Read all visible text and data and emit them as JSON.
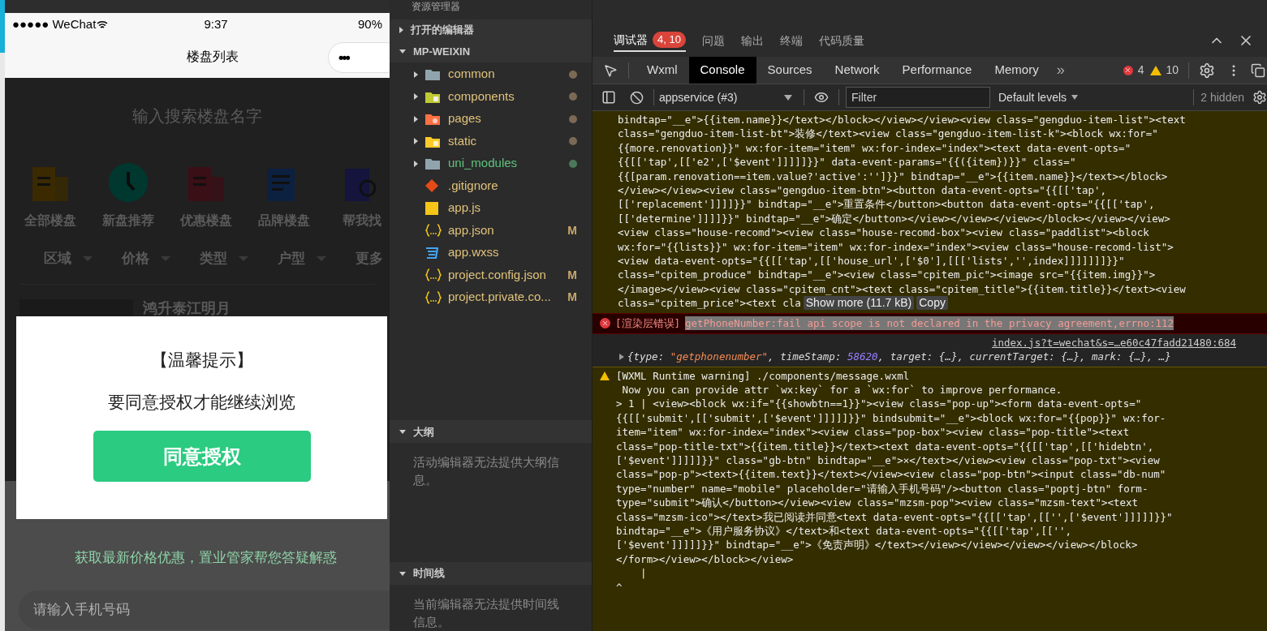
{
  "phone": {
    "status_bar": {
      "carrier": "●●●●● WeChat",
      "time": "9:37",
      "battery": "90%"
    },
    "nav": {
      "title": "楼盘列表",
      "menu": "•••"
    },
    "search": {
      "placeholder": "输入搜索楼盘名字"
    },
    "categories": [
      {
        "label": "全部楼盘",
        "kind": "building",
        "color": "#3b2a00"
      },
      {
        "label": "新盘推荐",
        "kind": "clock",
        "color": "#00382f"
      },
      {
        "label": "优惠楼盘",
        "kind": "building",
        "color": "#3a0f16"
      },
      {
        "label": "品牌楼盘",
        "kind": "document",
        "color": "#0c2040"
      },
      {
        "label": "帮我找",
        "kind": "search",
        "color": "#14143d"
      }
    ],
    "filters": [
      {
        "label": "区域"
      },
      {
        "label": "价格"
      },
      {
        "label": "类型"
      },
      {
        "label": "户型"
      },
      {
        "label": "更多"
      }
    ],
    "listing": {
      "title": "鸿升泰江明月"
    },
    "promo": "获取最新价格优惠，置业管家帮您答疑解惑",
    "phone_input": {
      "placeholder": "请输入手机号码"
    },
    "dialog": {
      "title": "【温馨提示】",
      "message": "要同意授权才能继续浏览",
      "button": "同意授权"
    }
  },
  "explorer": {
    "title": "资源管理器",
    "sections": [
      {
        "label": "打开的编辑器",
        "expanded": false
      },
      {
        "label": "MP-WEIXIN",
        "expanded": true
      }
    ],
    "files": [
      {
        "name": "common",
        "kind": "folder",
        "color": "#7a6a55",
        "highlight": false
      },
      {
        "name": "components",
        "kind": "folder",
        "color": "#7a6a55",
        "highlight": false
      },
      {
        "name": "pages",
        "kind": "folder",
        "color": "#7a6a55",
        "highlight": false
      },
      {
        "name": "static",
        "kind": "folder",
        "color": "#7a6a55",
        "highlight": false
      },
      {
        "name": "uni_modules",
        "kind": "folder",
        "color": "#4b7a5a",
        "highlight": true
      },
      {
        "name": ".gitignore",
        "kind": "file",
        "highlight": false
      },
      {
        "name": "app.js",
        "kind": "file",
        "highlight": false
      },
      {
        "name": "app.json",
        "kind": "file",
        "status": "M",
        "highlight": false
      },
      {
        "name": "app.wxss",
        "kind": "file",
        "highlight": false
      },
      {
        "name": "project.config.json",
        "kind": "file",
        "status": "M",
        "highlight": false
      },
      {
        "name": "project.private.co...",
        "kind": "file",
        "status": "M",
        "highlight": false
      }
    ],
    "outline": {
      "label": "大纲",
      "expanded": true,
      "message": "活动编辑器无法提供大纲信息。"
    },
    "timeline": {
      "label": "时间线",
      "expanded": true,
      "message": "当前编辑器无法提供时间线信息。"
    }
  },
  "devtools": {
    "panels": [
      {
        "label": "调试器",
        "selected": true,
        "badge": "4, 10"
      },
      {
        "label": "问题",
        "selected": false
      },
      {
        "label": "输出",
        "selected": false
      },
      {
        "label": "终端",
        "selected": false
      },
      {
        "label": "代码质量",
        "selected": false
      }
    ],
    "tabs": [
      {
        "label": "Wxml",
        "selected": false
      },
      {
        "label": "Console",
        "selected": true
      },
      {
        "label": "Sources",
        "selected": false
      },
      {
        "label": "Network",
        "selected": false
      },
      {
        "label": "Performance",
        "selected": false
      },
      {
        "label": "Memory",
        "selected": false
      }
    ],
    "more_tabs": "»",
    "errors": "4",
    "warnings": "10",
    "toolbar": {
      "context": "appservice (#3)",
      "filter": {
        "placeholder": "Filter"
      },
      "levels": "Default levels",
      "hidden": "2 hidden"
    },
    "messages": [
      {
        "kind": "log",
        "lines": [
          "bindtap=\"__e\">{{item.name}}</text></block></view></view><view class=\"gengduo-item-list\"><text",
          "class=\"gengduo-item-list-bt\">装修</text><view class=\"gengduo-item-list-k\"><block wx:for=\"",
          "{{more.renovation}}\" wx:for-item=\"item\" wx:for-index=\"index\"><text data-event-opts=\"",
          "{{[['tap',[['e2',['$event']]]]]}}\" data-event-params=\"{{({item})}}\" class=\"",
          "{{[param.renovation==item.value?'active':'']}}\" bindtap=\"__e\">{{item.name}}</text></block>",
          "</view></view><view class=\"gengduo-item-btn\"><button data-event-opts=\"{{[['tap',",
          "[['replacement']]]]}}\" bindtap=\"__e\">重置条件</button><button data-event-opts=\"{{[['tap',",
          "[['determine']]]]}}\" bindtap=\"__e\">确定</button></view></view></view></block></view></view>",
          "<view class=\"house-recomd\"><view class=\"house-recomd-box\"><view class=\"paddlist\"><block",
          "wx:for=\"{{lists}}\" wx:for-item=\"item\" wx:for-index=\"index\"><view class=\"house-recomd-list\">",
          "<view data-event-opts=\"{{[['tap',[['house_url',['$0'],[[['lists','',index]]]]]]]}}\"",
          "class=\"cpitem_produce\" bindtap=\"__e\"><view class=\"cpitem_pic\"><image src=\"{{item.img}}\">",
          "</image></view><view class=\"cpitem_cnt\"><text class=\"cpitem_title\">{{item.title}}</text><view",
          "class=\"cpitem_price\"><text cla"
        ],
        "show_more": "Show more (11.7 kB)",
        "copy": "Copy"
      },
      {
        "kind": "error",
        "prefix": "[渲染层错误]",
        "text": "getPhoneNumber:fail api scope is not declared in the privacy agreement,errno:112"
      },
      {
        "kind": "object",
        "source": "index.js?t=wechat&s=…e60c47fadd21480:684",
        "parts": [
          {
            "text": "{type: ",
            "kind": "plain"
          },
          {
            "text": "\"getphonenumber\"",
            "kind": "string"
          },
          {
            "text": ", timeStamp: ",
            "kind": "plain"
          },
          {
            "text": "58620",
            "kind": "number"
          },
          {
            "text": ", target: {…}, currentTarget: {…}, mark: {…}, …}",
            "kind": "plain"
          }
        ]
      },
      {
        "kind": "warning",
        "lines": [
          "[WXML Runtime warning] ./components/message.wxml",
          " Now you can provide attr `wx:key` for a `wx:for` to improve performance.",
          "> 1 | <view><block wx:if=\"{{showbtn==1}}\"><view class=\"pop-up\"><form data-event-opts=\"",
          "{{[['submit',[['submit',['$event']]]]]}}\" bindsubmit=\"__e\"><block wx:for=\"{{pop}}\" wx:for-",
          "item=\"item\" wx:for-index=\"index\"><view class=\"pop-box\"><view class=\"pop-title\"><text",
          "class=\"pop-title-txt\">{{item.title}}</text><text data-event-opts=\"{{[['tap',[['hidebtn',",
          "['$event']]]]]}}\" class=\"gb-btn\" bindtap=\"__e\">×</text></view><view class=\"pop-txt\"><view",
          "class=\"pop-p\"><text>{{item.text}}</text></view><view class=\"pop-btn\"><input class=\"db-num\"",
          "type=\"number\" name=\"mobile\" placeholder=\"请输入手机号码\"/><button class=\"poptj-btn\" form-",
          "type=\"submit\">确认</button></view><view class=\"mzsm-pop\"><view class=\"mzsm-text\"><text",
          "class=\"mzsm-ico\"></text>我已阅读并同意<text data-event-opts=\"{{[['tap',[['',['$event']]]]]}}\"",
          "bindtap=\"__e\">《用户服务协议》</text>和<text data-event-opts=\"{{[['tap',[['',",
          "['$event']]]]]}}\" bindtap=\"__e\">《免责声明》</text></view></view></view></view></block>",
          "</form></view></block></view>",
          "    |",
          "^"
        ]
      }
    ]
  }
}
